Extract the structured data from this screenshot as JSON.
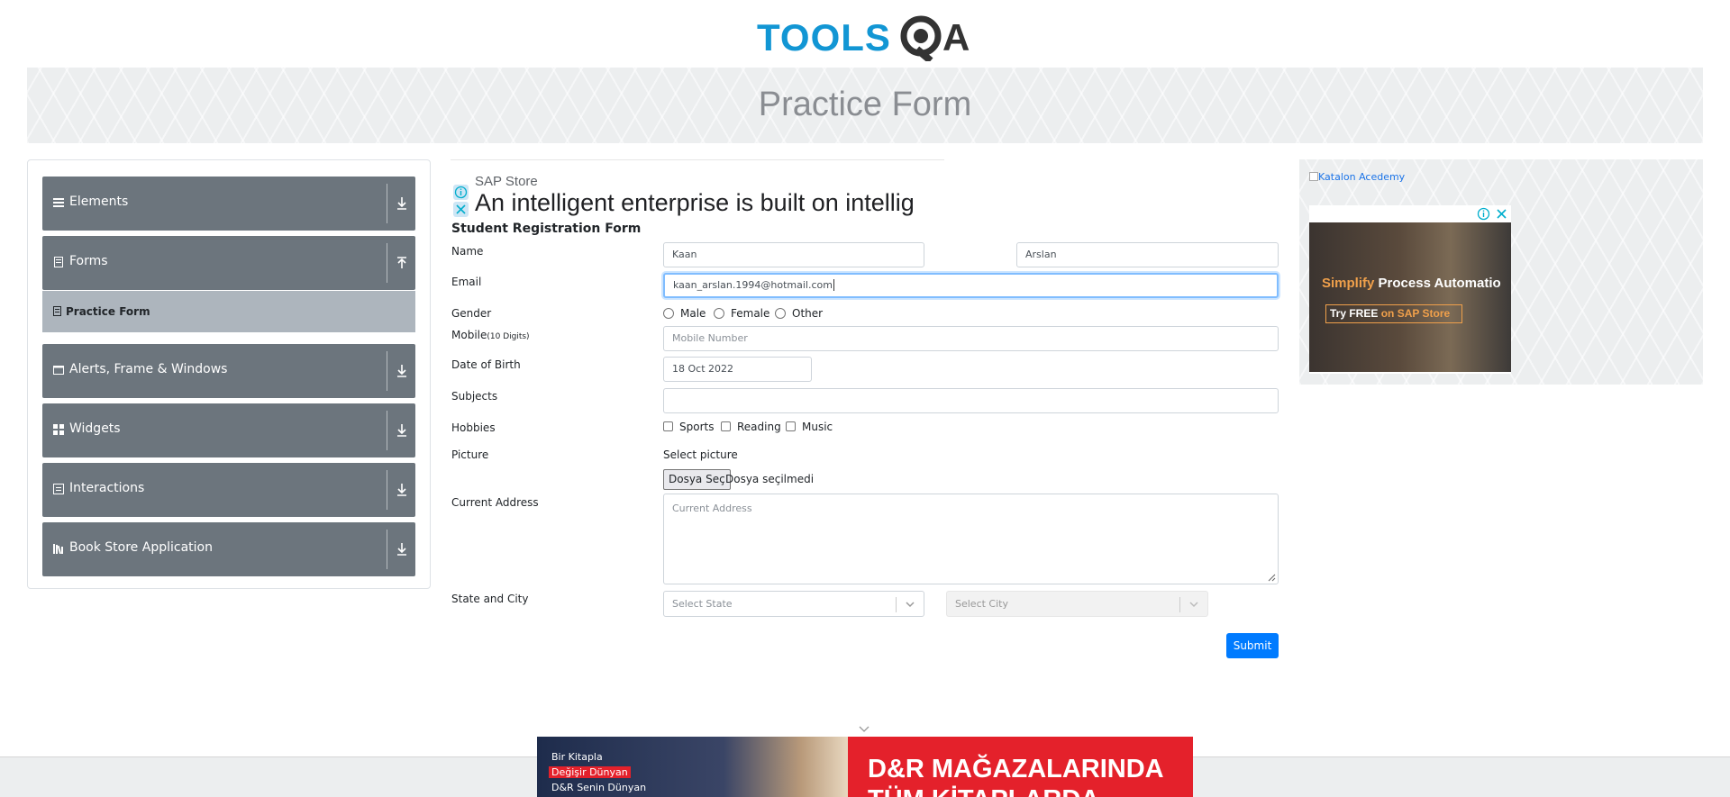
{
  "logo": {
    "text_tools": "TOOLS",
    "text_qa": "QA"
  },
  "banner": {
    "title": "Practice Form"
  },
  "sidebar": {
    "groups": [
      {
        "label": "Elements",
        "icon": "menu-icon"
      },
      {
        "label": "Forms",
        "icon": "document-icon"
      },
      {
        "label": "Alerts, Frame & Windows",
        "icon": "window-icon"
      },
      {
        "label": "Widgets",
        "icon": "grid-icon"
      },
      {
        "label": "Interactions",
        "icon": "list-icon"
      },
      {
        "label": "Book Store Application",
        "icon": "books-icon"
      }
    ],
    "active_item": "Practice Form"
  },
  "top_ad": {
    "advertiser": "SAP Store",
    "headline": "An intelligent enterprise is built on intellig"
  },
  "form": {
    "title": "Student Registration Form",
    "labels": {
      "name": "Name",
      "email": "Email",
      "gender": "Gender",
      "mobile": "Mobile",
      "mobile_hint": "(10 Digits)",
      "dob": "Date of Birth",
      "subjects": "Subjects",
      "hobbies": "Hobbies",
      "picture": "Picture",
      "address": "Current Address",
      "state_city": "State and City"
    },
    "first_name": "Kaan",
    "last_name": "Arslan",
    "email": "kaan_arslan.1994@hotmail.com",
    "genders": [
      "Male",
      "Female",
      "Other"
    ],
    "mobile_placeholder": "Mobile Number",
    "dob": "18 Oct 2022",
    "subjects": "",
    "hobbies": [
      "Sports",
      "Reading",
      "Music"
    ],
    "picture_label": "Select picture",
    "file_button": "Dosya Seç",
    "file_status": "Dosya seçilmedi",
    "address_placeholder": "Current Address",
    "state_placeholder": "Select State",
    "city_placeholder": "Select City",
    "submit": "Submit"
  },
  "right_ad": {
    "katalon_alt": "Katalon Acedemy",
    "headline_a": "Simplify",
    "headline_b": "Process Automatio",
    "cta_a": "Try FREE",
    "cta_b": "on SAP Store"
  },
  "bottom_ad": {
    "line1": "Bir Kitapla",
    "line2": "Değişir Dünyan",
    "line3": "D&R Senin Dünyan",
    "big1": "D&R MAĞAZALARINDA",
    "big2": "TÜM KİTAPLARDA"
  },
  "colors": {
    "brand_blue": "#1296d4",
    "sidebar_gray": "#6c757d",
    "submit_blue": "#007bff",
    "ad_red": "#e4212b"
  }
}
